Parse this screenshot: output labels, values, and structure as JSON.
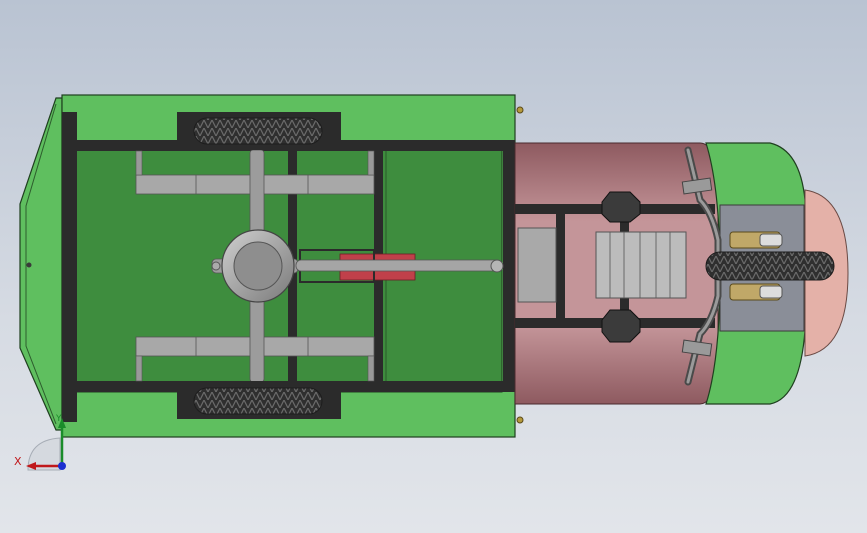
{
  "viewport": {
    "background_top": "#b9c3d2",
    "background_bottom": "#e2e5ea"
  },
  "colors": {
    "body_green": "#5fbf5f",
    "floor_green": "#3e8d3e",
    "frame_dark": "#2b2b2b",
    "mauve": "#b9868a",
    "mauve_dark": "#8f5f64",
    "grey_part": "#a9a9a9",
    "tire": "#3a3a3a",
    "red_part": "#c0404a",
    "fender_pink": "#e4b1a8",
    "axis_x": "#c0181b",
    "axis_y": "#1a8c2a",
    "axis_z": "#1b2fd0"
  },
  "icons": {
    "triad": "coordinate-triad-icon"
  },
  "triad": {
    "x_label": "X",
    "y_label": "Y"
  }
}
